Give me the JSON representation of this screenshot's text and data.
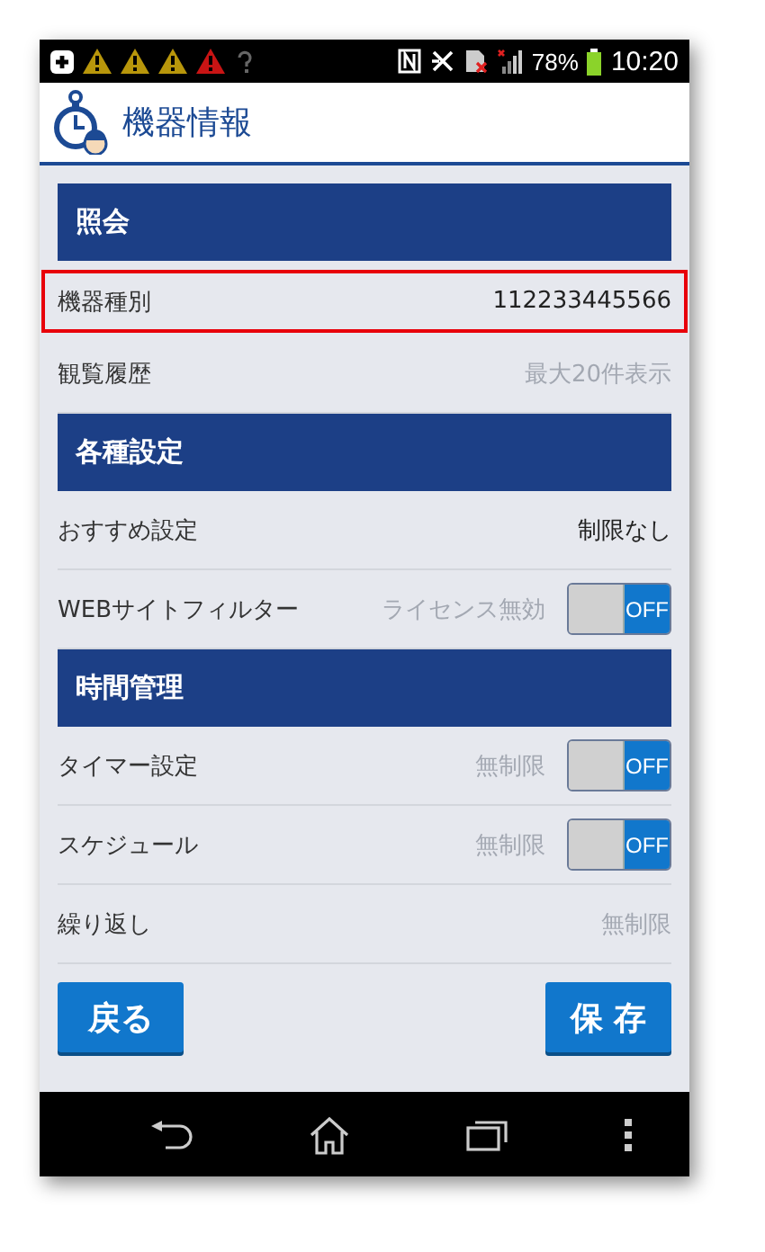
{
  "status_bar": {
    "battery": "78%",
    "time": "10:20"
  },
  "header": {
    "title": "機器情報"
  },
  "sections": [
    {
      "title": "照会",
      "rows": [
        {
          "kind": "value",
          "label": "機器種別",
          "value": "112233445566",
          "disabled": false,
          "highlighted": true
        },
        {
          "kind": "value",
          "label": "観覧履歴",
          "value": "最大20件表示",
          "disabled": true
        }
      ]
    },
    {
      "title": "各種設定",
      "rows": [
        {
          "kind": "value",
          "label": "おすすめ設定",
          "value": "制限なし",
          "disabled": false
        },
        {
          "kind": "toggle",
          "label": "WEBサイトフィルター",
          "value": "ライセンス無効",
          "disabled": true,
          "on": false,
          "toggle_label": "OFF"
        }
      ]
    },
    {
      "title": "時間管理",
      "rows": [
        {
          "kind": "toggle",
          "label": "タイマー設定",
          "value": "無制限",
          "disabled": true,
          "on": false,
          "toggle_label": "OFF"
        },
        {
          "kind": "toggle",
          "label": "スケジュール",
          "value": "無制限",
          "disabled": true,
          "on": false,
          "toggle_label": "OFF"
        },
        {
          "kind": "value",
          "label": "繰り返し",
          "value": "無制限",
          "disabled": true
        }
      ]
    }
  ],
  "buttons": {
    "back": "戻る",
    "save": "保 存"
  }
}
